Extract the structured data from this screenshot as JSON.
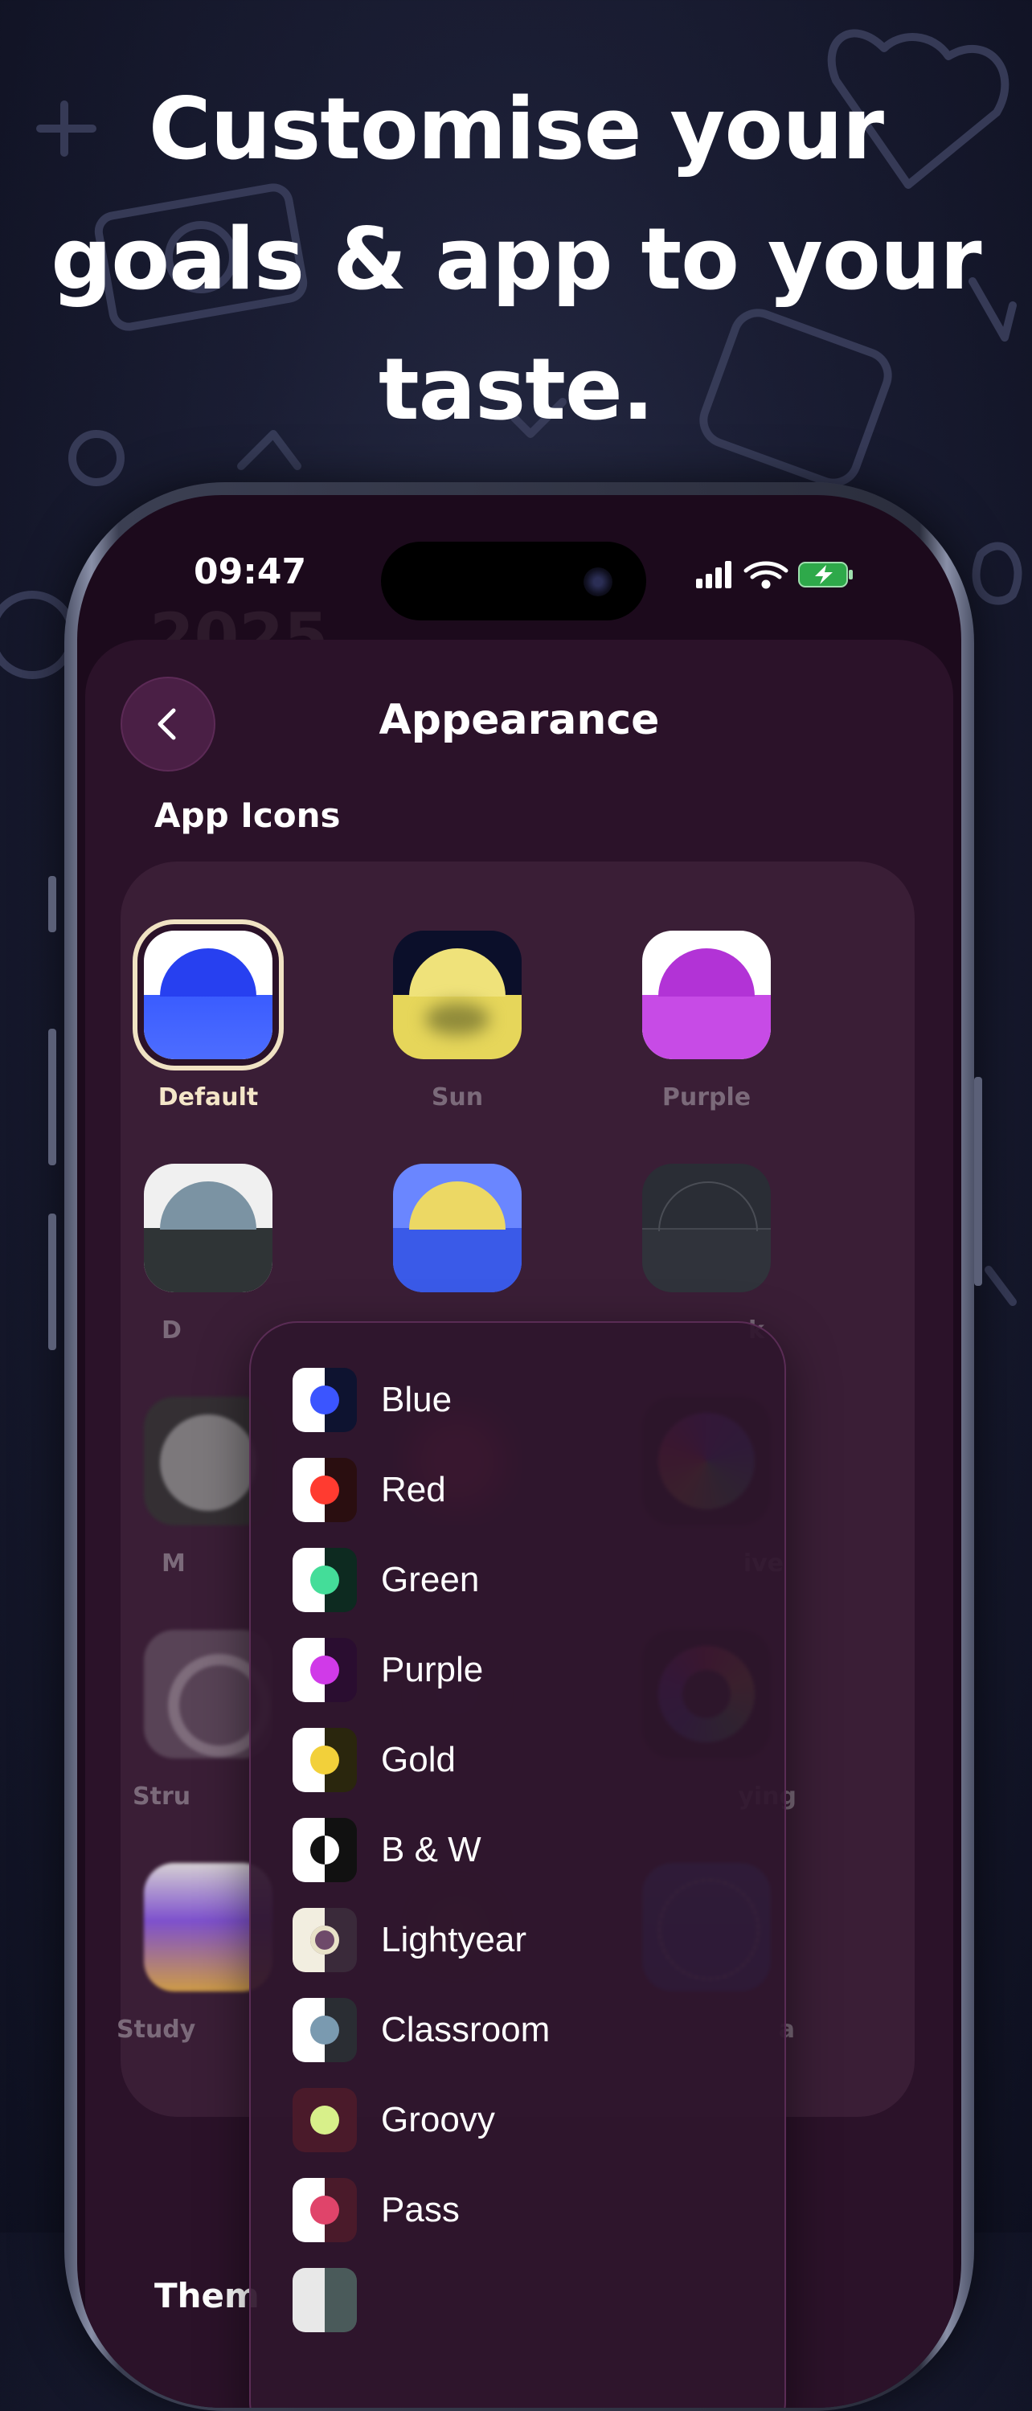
{
  "headline": "Customise your goals & app to your taste.",
  "status_bar": {
    "time": "09:47"
  },
  "ghost_header": "2025",
  "screen": {
    "title": "Appearance",
    "back_icon": "chevron-left-icon",
    "section_app_icons": "App Icons",
    "section_themes": "Them"
  },
  "app_icons": [
    {
      "label": "Default",
      "selected": true
    },
    {
      "label": "Sun",
      "selected": false
    },
    {
      "label": "Purple",
      "selected": false
    },
    {
      "label": "D",
      "selected": false
    },
    {
      "label": "",
      "selected": false
    },
    {
      "label": "k",
      "selected": false
    },
    {
      "label": "M",
      "selected": false
    },
    {
      "label": "",
      "selected": false
    },
    {
      "label": "ive",
      "selected": false
    },
    {
      "label": "Stru",
      "selected": false
    },
    {
      "label": "",
      "selected": false
    },
    {
      "label": "ying",
      "selected": false
    },
    {
      "label": "Study",
      "selected": false
    },
    {
      "label": "",
      "selected": false
    },
    {
      "label": "a",
      "selected": false
    }
  ],
  "menu": {
    "items": [
      {
        "label": "Blue",
        "dot": "#3b55ff",
        "left": "#ffffff",
        "right": "#0e1330"
      },
      {
        "label": "Red",
        "dot": "#ff3b30",
        "left": "#ffffff",
        "right": "#2a0e10"
      },
      {
        "label": "Green",
        "dot": "#44dd99",
        "left": "#ffffff",
        "right": "#0d2a20"
      },
      {
        "label": "Purple",
        "dot": "#d03ae8",
        "left": "#ffffff",
        "right": "#2a0d30"
      },
      {
        "label": "Gold",
        "dot": "#f2d03a",
        "left": "#ffffff",
        "right": "#2a260d"
      },
      {
        "label": "B & W",
        "dot": "#111111",
        "left": "#ffffff",
        "right": "#111111"
      },
      {
        "label": "Lightyear",
        "dot": "#6e4a6a",
        "left": "#f2eee0",
        "right": "#3a2a3a"
      },
      {
        "label": "Classroom",
        "dot": "#7a9ab0",
        "left": "#ffffff",
        "right": "#2a2d33"
      },
      {
        "label": "Groovy",
        "dot": "#d8f08a",
        "left": "#4a1a2a",
        "right": "#4a1a2a"
      },
      {
        "label": "Pass",
        "dot": "#e0446a",
        "left": "#ffffff",
        "right": "#4a1a2a"
      }
    ]
  }
}
